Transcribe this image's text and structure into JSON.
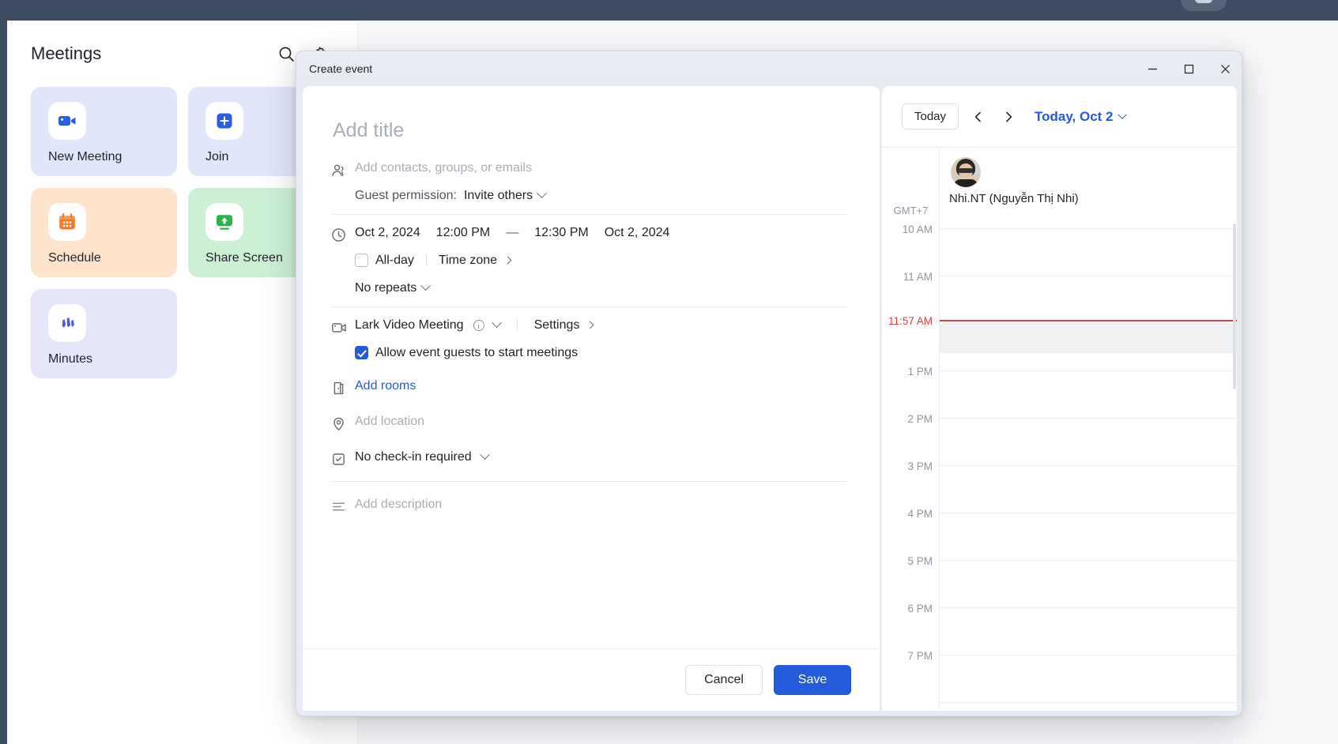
{
  "app": {
    "title": "Meetings",
    "header_icons": [
      {
        "name": "search-icon",
        "label": "Search"
      },
      {
        "name": "gear-icon",
        "label": "Settings"
      }
    ],
    "tiles": [
      {
        "label": "New Meeting",
        "icon": "video-camera-icon",
        "theme": "blue"
      },
      {
        "label": "Join",
        "icon": "plus-square-icon",
        "theme": "blue"
      },
      {
        "label": "Schedule",
        "icon": "calendar-icon",
        "theme": "orange"
      },
      {
        "label": "Share Screen",
        "icon": "screen-share-icon",
        "theme": "green"
      },
      {
        "label": "Minutes",
        "icon": "minutes-icon",
        "theme": "purple"
      }
    ]
  },
  "dialog": {
    "title": "Create event",
    "window_buttons": {
      "minimize": "minimize-icon",
      "maximize": "maximize-icon",
      "close": "close-icon"
    },
    "form": {
      "title_placeholder": "Add title",
      "title_value": "",
      "guests_placeholder": "Add contacts, groups, or emails",
      "guest_permission_label": "Guest permission:",
      "guest_permission_value": "Invite others",
      "start_date": "Oct 2, 2024",
      "start_time": "12:00 PM",
      "range_dash": "—",
      "end_time": "12:30 PM",
      "end_date": "Oct 2, 2024",
      "all_day_label": "All-day",
      "all_day_checked": false,
      "time_zone_label": "Time zone",
      "repeat_value": "No repeats",
      "video_provider": "Lark Video Meeting",
      "settings_label": "Settings",
      "allow_guests_label": "Allow event guests to start meetings",
      "allow_guests_checked": true,
      "add_rooms_label": "Add rooms",
      "location_placeholder": "Add location",
      "checkin_value": "No check-in required",
      "description_placeholder": "Add description"
    },
    "footer": {
      "cancel_label": "Cancel",
      "save_label": "Save"
    },
    "calendar": {
      "today_label": "Today",
      "prev_label": "Previous day",
      "next_label": "Next day",
      "date_label": "Today, Oct 2",
      "timezone_label": "GMT+7",
      "current_time_label": "11:57 AM",
      "attendee_name": "Nhi.NT (Nguyễn Thị Nhi)",
      "time_labels": [
        "10 AM",
        "11 AM",
        "1 PM",
        "2 PM",
        "3 PM",
        "4 PM",
        "5 PM",
        "6 PM",
        "7 PM"
      ]
    }
  },
  "colors": {
    "accent": "#245bdb",
    "now_line": "#e13c3c",
    "os_chrome": "#3d4b63",
    "tile_blue": "#e2e6fb",
    "tile_orange": "#fde4cb",
    "tile_green": "#ccf0d4",
    "tile_purple": "#e6e6fb"
  }
}
